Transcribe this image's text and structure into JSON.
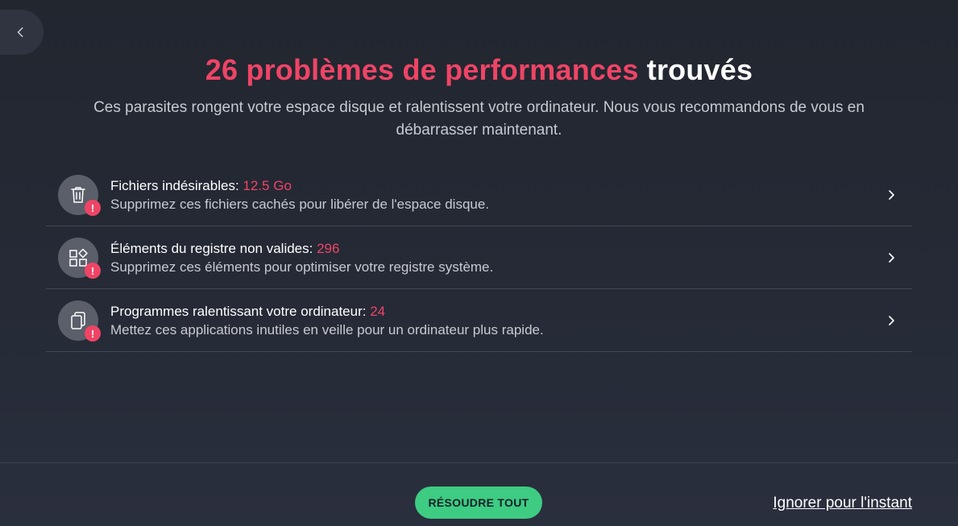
{
  "nav": {
    "back_icon": "chevron-left-icon"
  },
  "header": {
    "title_highlight": "26 problèmes de performances",
    "title_rest": "trouvés",
    "subtitle": "Ces parasites rongent votre espace disque et ralentissent votre ordinateur. Nous vous recommandons de vous en débarrasser maintenant."
  },
  "issues": [
    {
      "icon": "trash-icon",
      "label": "Fichiers indésirables:",
      "value": "12.5 Go",
      "description": "Supprimez ces fichiers cachés pour libérer de l'espace disque."
    },
    {
      "icon": "registry-icon",
      "label": "Éléments du registre non valides:",
      "value": "296",
      "description": "Supprimez ces éléments pour optimiser votre registre système."
    },
    {
      "icon": "apps-stack-icon",
      "label": "Programmes ralentissant votre ordinateur:",
      "value": "24",
      "description": "Mettez ces applications inutiles en veille pour un ordinateur plus rapide."
    }
  ],
  "alert_badge": "!",
  "footer": {
    "resolve_label": "RÉSOUDRE TOUT",
    "ignore_label": "Ignorer pour l'instant"
  },
  "colors": {
    "accent": "#ef4466",
    "primary_button": "#3dcc82",
    "background": "#252a36"
  }
}
